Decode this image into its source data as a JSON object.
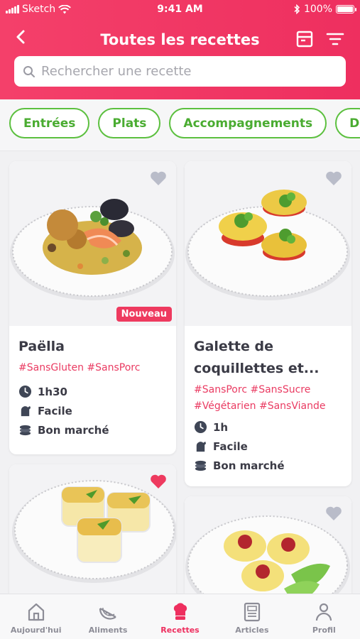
{
  "status_bar": {
    "carrier": "Sketch",
    "time": "9:41 AM",
    "battery": "100%"
  },
  "header": {
    "title": "Toutes les recettes"
  },
  "search": {
    "placeholder": "Rechercher une recette"
  },
  "categories": [
    "Entrées",
    "Plats",
    "Accompagnements",
    "D"
  ],
  "recipes": [
    {
      "title_line1": "Paëlla",
      "title_line2": "",
      "tags_line1": "#SansGluten #SansPorc",
      "tags_line2": "",
      "time": "1h30",
      "difficulty": "Facile",
      "cost": "Bon marché",
      "badge": "Nouveau",
      "favorite": false
    },
    {
      "title_line1": "Galette de",
      "title_line2": "coquillettes et...",
      "tags_line1": "#SansPorc #SansSucre",
      "tags_line2": "#Végétarien #SansViande",
      "time": "1h",
      "difficulty": "Facile",
      "cost": "Bon marché",
      "badge": "",
      "favorite": false
    },
    {
      "favorite": true
    },
    {
      "favorite": false
    }
  ],
  "tabs": [
    {
      "label": "Aujourd'hui",
      "icon": "home-icon",
      "active": false
    },
    {
      "label": "Aliments",
      "icon": "melon-icon",
      "active": false
    },
    {
      "label": "Recettes",
      "icon": "chef-hat-icon",
      "active": true
    },
    {
      "label": "Articles",
      "icon": "article-icon",
      "active": false
    },
    {
      "label": "Profil",
      "icon": "person-icon",
      "active": false
    }
  ],
  "colors": {
    "brand": "#ee2f5f",
    "chip_green": "#5cc03f",
    "heart_inactive": "#b9bcc9",
    "heart_active": "#ee3a5f"
  }
}
